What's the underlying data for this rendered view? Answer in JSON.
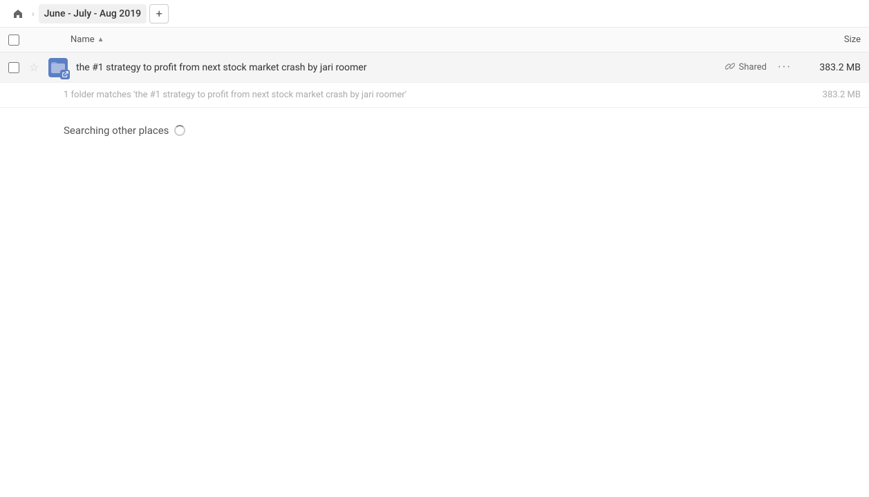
{
  "breadcrumb": {
    "home_label": "Home",
    "item_label": "June - July - Aug 2019",
    "add_button_label": "+"
  },
  "columns": {
    "name_label": "Name",
    "size_label": "Size"
  },
  "file_row": {
    "name": "the #1 strategy to profit from next stock market crash by jari roomer",
    "shared_label": "Shared",
    "size": "383.2 MB"
  },
  "match_info": {
    "text": "1 folder matches 'the #1 strategy to profit from next stock market crash by jari roomer'",
    "size": "383.2 MB"
  },
  "searching": {
    "title": "Searching other places"
  },
  "icons": {
    "home": "⌂",
    "chevron": "›",
    "star_empty": "☆",
    "link": "🔗",
    "more": "•••",
    "folder_char": "📁"
  }
}
